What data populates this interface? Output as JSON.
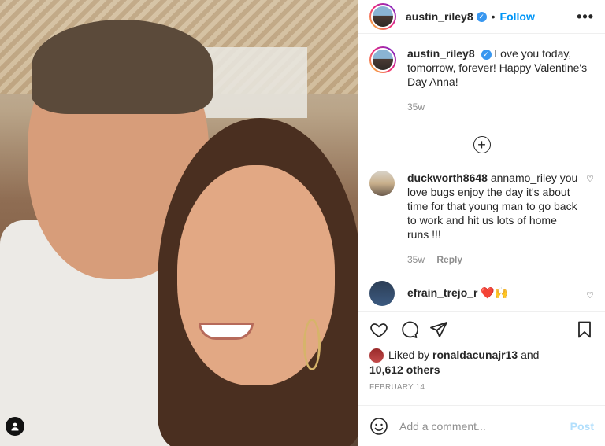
{
  "header": {
    "username": "austin_riley8",
    "verified_icon": "verified-badge-icon",
    "separator": "•",
    "follow_label": "Follow",
    "more_label": "•••"
  },
  "caption": {
    "username": "austin_riley8",
    "text": "Love you today, tomorrow, forever! Happy Valentine's Day Anna!",
    "time": "35w"
  },
  "load_more_label": "+",
  "comments": [
    {
      "username": "duckworth8648",
      "text": "annamo_riley you love bugs enjoy the day it's about time for that young man to go back to work and hit us lots of home runs !!!",
      "time": "35w",
      "reply_label": "Reply"
    },
    {
      "username": "efrain_trejo_r",
      "text": "❤️🙌"
    }
  ],
  "likes": {
    "prefix": "Liked by",
    "user": "ronaldacunajr13",
    "and": "and",
    "others": "10,612 others"
  },
  "date": "FEBRUARY 14",
  "add_comment": {
    "placeholder": "Add a comment...",
    "post_label": "Post"
  },
  "colors": {
    "accent": "#0095f6",
    "post_disabled": "#b2dffc",
    "muted": "#8e8e8e"
  }
}
